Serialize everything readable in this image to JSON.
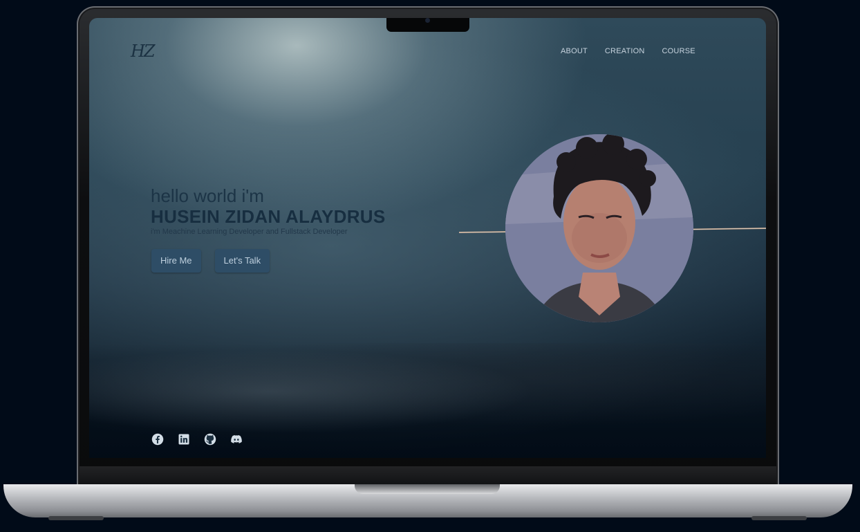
{
  "site": {
    "logo_text": "HZ",
    "nav": [
      {
        "label": "ABOUT"
      },
      {
        "label": "CREATION"
      },
      {
        "label": "COURSE"
      }
    ]
  },
  "hero": {
    "greeting": "hello world i'm",
    "name": "HUSEIN ZIDAN ALAYDRUS",
    "subtitle": "i'm Meachine Learning Developer and Fullstack Developer",
    "buttons": [
      {
        "label": "Hire Me"
      },
      {
        "label": "Let's Talk"
      }
    ]
  },
  "socials": [
    {
      "icon": "facebook-icon"
    },
    {
      "icon": "linkedin-icon"
    },
    {
      "icon": "github-icon"
    },
    {
      "icon": "discord-icon"
    }
  ],
  "colors": {
    "page_background": "#010b18",
    "button_background": "#2e4d66",
    "heading_color": "#172e40",
    "nav_color": "#c7d3de"
  }
}
